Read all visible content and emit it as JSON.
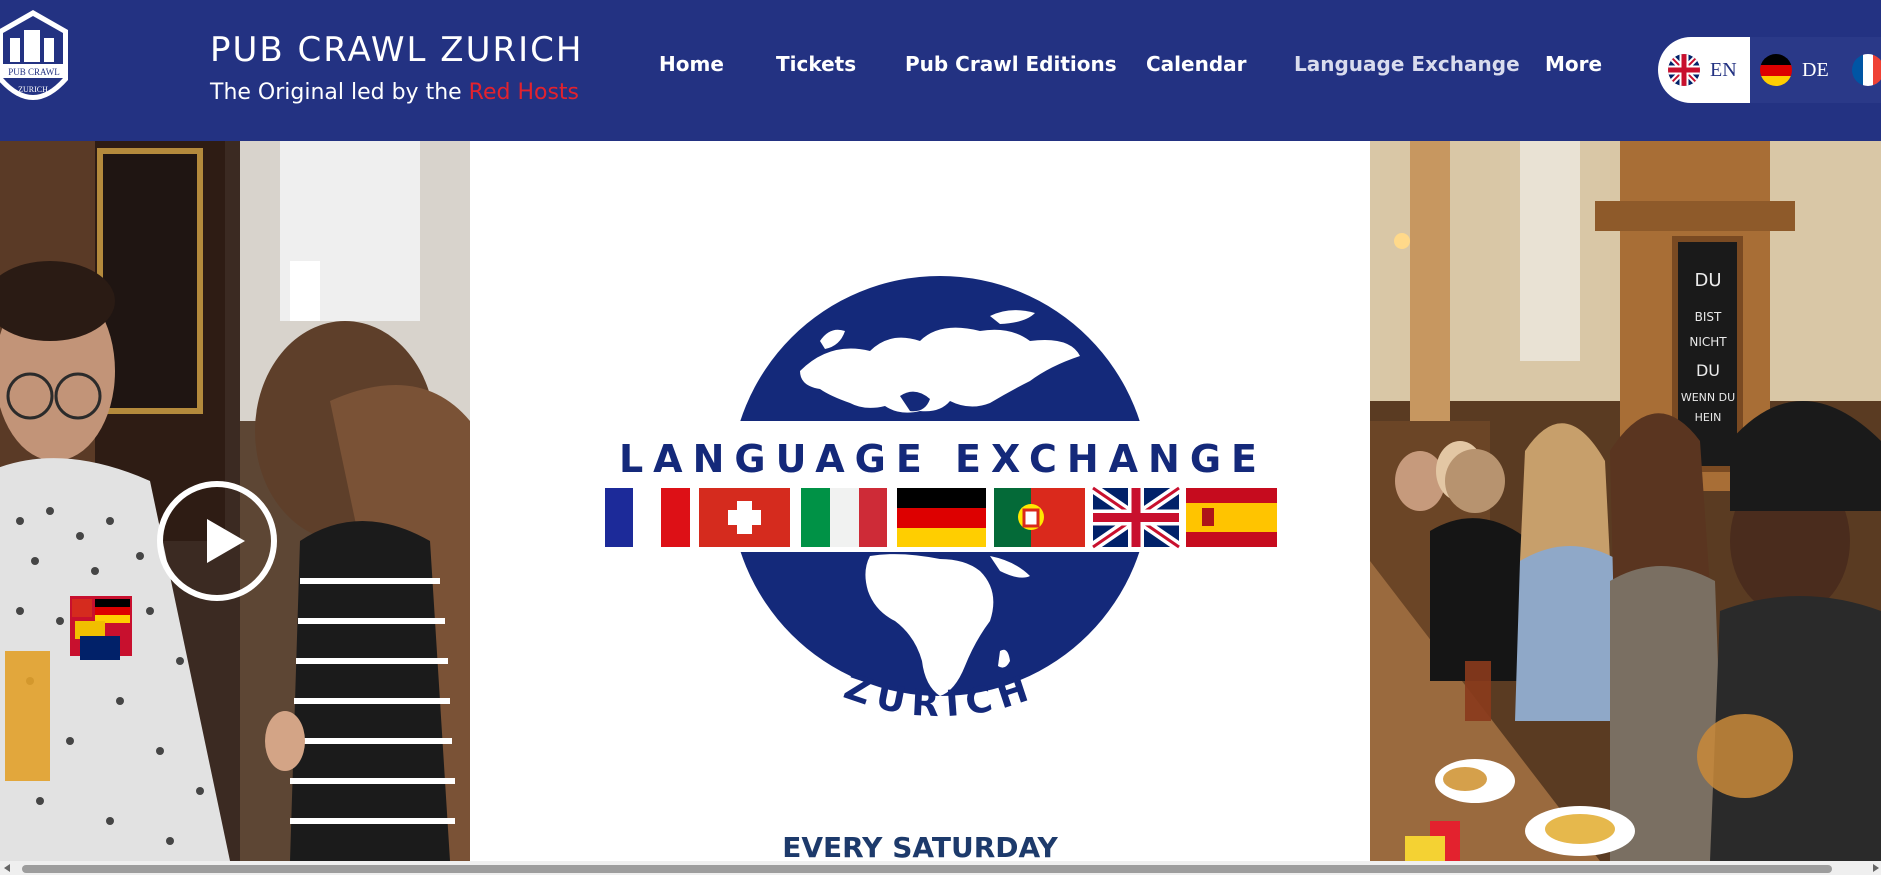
{
  "brand": {
    "title": "PUB CRAWL ZURICH",
    "subtitle_prefix": "The Original led by the ",
    "subtitle_highlight": "Red Hosts",
    "logo_text_top": "PUB CRAWL",
    "logo_text_bottom": "ZURICH"
  },
  "nav": {
    "items": [
      {
        "label": "Home"
      },
      {
        "label": "Tickets"
      },
      {
        "label": "Pub Crawl Editions"
      },
      {
        "label": "Calendar"
      },
      {
        "label": "Language Exchange",
        "active": true
      },
      {
        "label": "More"
      }
    ]
  },
  "languages": [
    {
      "code": "EN",
      "icon": "uk-flag-icon",
      "selected": true
    },
    {
      "code": "DE",
      "icon": "de-flag-icon",
      "selected": false
    }
  ],
  "hero": {
    "title": "LANGUAGE EXCHANGE",
    "city": "ZURICH",
    "schedule": "EVERY SATURDAY",
    "flags": [
      "france-flag-icon",
      "switzerland-flag-icon",
      "italy-flag-icon",
      "germany-flag-icon",
      "portugal-flag-icon",
      "uk-flag-icon",
      "spain-flag-icon"
    ],
    "chalkboard_text": [
      "DU",
      "BIST",
      "NICHT",
      "DU",
      "WENN DU",
      "HEIN"
    ]
  },
  "colors": {
    "header_bg": "#233282",
    "accent_red": "#e3222e",
    "globe_blue": "#14297a"
  }
}
